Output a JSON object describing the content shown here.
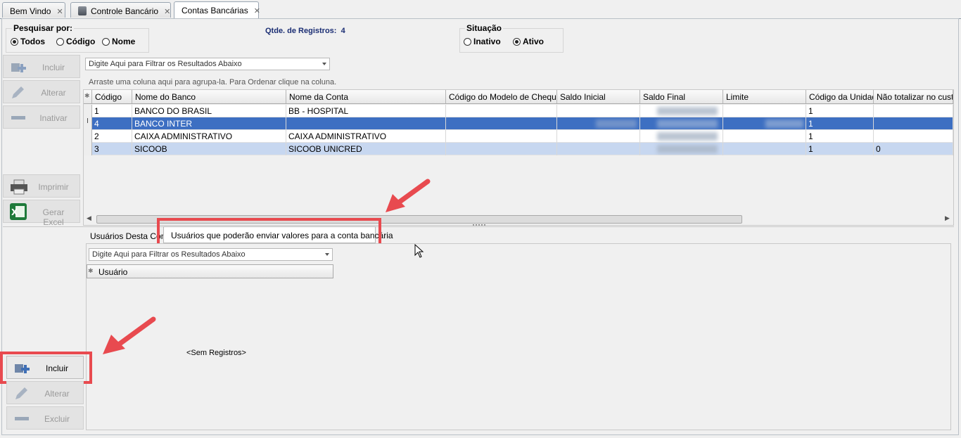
{
  "tabs": [
    {
      "label": "Bem Vindo",
      "close": "✕"
    },
    {
      "label": "Controle Bancário",
      "close": "✕"
    },
    {
      "label": "Contas Bancárias",
      "close": "✕"
    }
  ],
  "search": {
    "title": "Pesquisar por:",
    "options": [
      "Todos",
      "Código",
      "Nome"
    ],
    "selected": "Todos"
  },
  "registros": {
    "label": "Qtde. de Registros:",
    "count": "4"
  },
  "situacao": {
    "title": "Situação",
    "options": [
      "Inativo",
      "Ativo"
    ],
    "selected": "Ativo"
  },
  "top_buttons": {
    "incluir": "Incluir",
    "alterar": "Alterar",
    "inativar": "Inativar",
    "imprimir": "Imprimir",
    "gerar_excel": "Gerar Excel"
  },
  "grid": {
    "filter_placeholder": "Digite Aqui para Filtrar os Resultados Abaixo",
    "group_hint": "Arraste uma coluna aqui para agrupa-la. Para Ordenar clique na coluna.",
    "columns": [
      "Código",
      "Nome do Banco",
      "Nome da Conta",
      "Código do Modelo de Cheque",
      "Saldo Inicial",
      "Saldo Final",
      "Limite",
      "Código da Unidade",
      "Não totalizar no custo A"
    ],
    "rows": [
      {
        "codigo": "1",
        "banco": "BANCO DO BRASIL",
        "conta": "BB - HOSPITAL",
        "unidade": "1",
        "nao_totalizar": ""
      },
      {
        "codigo": "4",
        "banco": "BANCO INTER",
        "conta": "",
        "unidade": "1",
        "nao_totalizar": ""
      },
      {
        "codigo": "2",
        "banco": "CAIXA ADMINISTRATIVO",
        "conta": "CAIXA ADMINISTRATIVO",
        "unidade": "1",
        "nao_totalizar": ""
      },
      {
        "codigo": "3",
        "banco": "SICOOB",
        "conta": "SICOOB UNICRED",
        "unidade": "1",
        "nao_totalizar": "0"
      }
    ]
  },
  "subtabs": [
    "Usuários Desta Conta",
    "Usuários que poderão enviar valores para a conta bancária"
  ],
  "subgrid": {
    "filter_placeholder": "Digite Aqui para Filtrar os Resultados Abaixo",
    "column": "Usuário",
    "empty": "<Sem Registros>"
  },
  "bottom_buttons": {
    "incluir": "Incluir",
    "alterar": "Alterar",
    "excluir": "Excluir"
  },
  "colors": {
    "selection": "#3d6fc2",
    "alt_row": "#c7d7f0",
    "highlight": "#e84a4f"
  }
}
